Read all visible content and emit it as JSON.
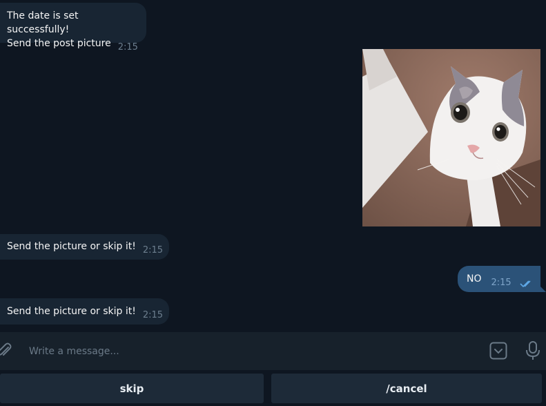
{
  "messages": {
    "m1": {
      "line1": "The date is set successfully!",
      "line2": "Send the post picture",
      "time": "2:15"
    },
    "m2": {
      "text": "Send the picture or skip it!",
      "time": "2:15"
    },
    "m3": {
      "text": "Send the picture or skip it!",
      "time": "2:15"
    },
    "m4": {
      "text": "NO",
      "time": "2:15"
    }
  },
  "composer": {
    "placeholder": "Write a message..."
  },
  "keyboard": {
    "buttons": [
      "skip",
      "/cancel"
    ]
  },
  "colors": {
    "background": "#0e1621",
    "incoming_bubble": "#182533",
    "outgoing_bubble": "#2b5278",
    "composer": "#17212b",
    "keyboard_button": "#1d2a38",
    "read_ticks": "#5fa9e8"
  },
  "icons": [
    "attach-icon",
    "keyboard-icon",
    "mic-icon",
    "double-check-icon"
  ]
}
